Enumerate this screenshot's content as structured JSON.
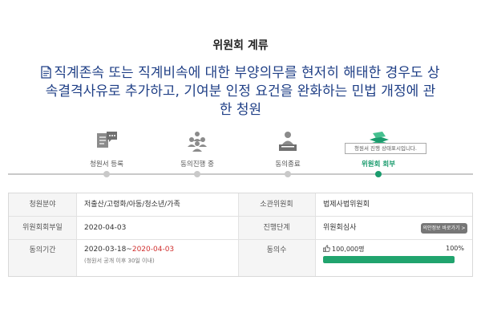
{
  "header": {
    "status": "위원회 계류"
  },
  "petition": {
    "title": "직계존속 또는 직계비속에 대한 부양의무를 현저히 해태한 경우도 상속결격사유로 추가하고, 기여분 인정 요건을 완화하는 민법 개정에 관한 청원"
  },
  "steps": [
    {
      "label": "청원서 등록",
      "icon": "document-speech-icon"
    },
    {
      "label": "동의진행 중",
      "icon": "people-group-icon"
    },
    {
      "label": "동의종료",
      "icon": "person-desk-icon"
    },
    {
      "label": "위원회 회부",
      "icon": "stacked-papers-icon",
      "active": true
    }
  ],
  "tooltip": "청원서 진행 상태표시입니다.",
  "table": {
    "field_label": "청원분야",
    "field_value": "저출산/고령화/아동/청소년/가족",
    "committee_label": "소관위원회",
    "committee_value": "법제사법위원회",
    "referral_date_label": "위원회회부일",
    "referral_date_value": "2020-04-03",
    "stage_label": "진행단계",
    "stage_value": "위원회심사",
    "detail_button": "의안정보 바로가기 >",
    "period_label": "동의기간",
    "period_start": "2020-03-18~",
    "period_end": "2020-04-03",
    "period_note": "(청원서 공개 이후 30일 이내)",
    "agree_label": "동의수",
    "agree_count": "100,000명",
    "agree_percent_label": "100%",
    "agree_percent": 100
  },
  "colors": {
    "accent": "#21a46e",
    "title": "#1f3f86",
    "deadline": "#d0302f"
  }
}
